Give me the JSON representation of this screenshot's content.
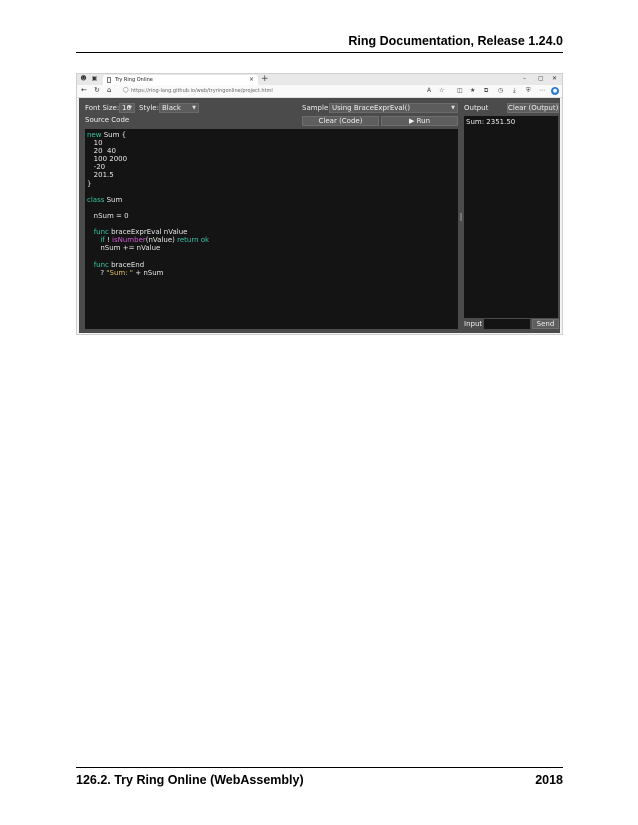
{
  "document": {
    "header": "Ring Documentation, Release 1.24.0",
    "footer_section": "126.2. Try Ring Online (WebAssembly)",
    "footer_page": "2018"
  },
  "browser": {
    "tab_title": "Try Ring Online",
    "tab_close": "×",
    "new_tab": "+",
    "url": "https://ring-lang.github.io/web/tryringonline/project.html",
    "window_controls": [
      "–",
      "▢",
      "✕"
    ],
    "icons": [
      "profile-icon",
      "tab-actions-icon",
      "back-icon",
      "refresh-icon",
      "home-icon",
      "read-aloud-icon",
      "favorite-icon",
      "split-screen-icon",
      "favorites-icon",
      "collections-icon",
      "history-icon",
      "downloads-icon",
      "extensions-icon",
      "more-icon"
    ]
  },
  "app": {
    "font_size_label": "Font Size:",
    "font_size_value": "16",
    "style_label": "Style:",
    "style_value": "Black",
    "sample_label": "Sample",
    "sample_value": "Using BraceExprEval()",
    "output_label": "Output",
    "clear_output_button": "Clear (Output)",
    "source_code_label": "Source Code",
    "clear_code_button": "Clear (Code)",
    "run_button": "▶ Run",
    "output_text": "Sum: 2351.50",
    "input_label": "Input",
    "input_value": "",
    "send_button": "Send",
    "code": {
      "l1_kw": "new",
      "l1_rest": " Sum {",
      "l2": "   10",
      "l3": "   20  40",
      "l4": "   100 2000",
      "l5": "   -20",
      "l6": "   201.5",
      "l7": "}",
      "l8": "",
      "l9_kw": "class",
      "l9_rest": " Sum",
      "l10": "",
      "l11": "   nSum = 0",
      "l12": "",
      "l13_indent": "   ",
      "l13_kw": "func",
      "l13_rest": " braceExprEval nValue",
      "l14_indent": "      ",
      "l14_kw": "if",
      "l14_mid": " ! ",
      "l14_fn": "isNumber",
      "l14_mid2": "(nValue) ",
      "l14_kw2": "return ok",
      "l15": "      nSum += nValue",
      "l16": "",
      "l17_indent": "   ",
      "l17_kw": "func",
      "l17_rest": " braceEnd",
      "l18_pre": "      ? ",
      "l18_str": "\"Sum: \"",
      "l18_rest": " + nSum"
    }
  }
}
